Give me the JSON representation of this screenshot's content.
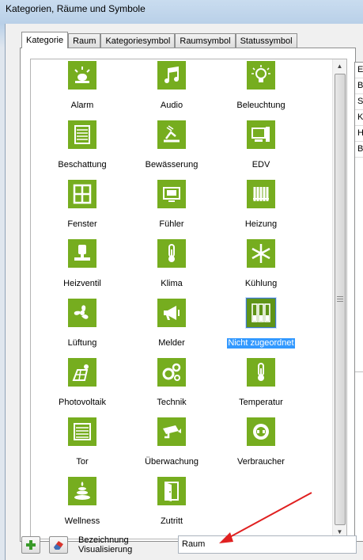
{
  "window": {
    "title": "Kategorien, Räume und Symbole"
  },
  "tabs": [
    "Kategorie",
    "Raum",
    "Kategoriesymbol",
    "Raumsymbol",
    "Statussymbol"
  ],
  "active_tab": "Kategorie",
  "categories": [
    {
      "label": "Alarm",
      "icon": "alarm-icon"
    },
    {
      "label": "Audio",
      "icon": "music-icon"
    },
    {
      "label": "Beleuchtung",
      "icon": "lightbulb-icon"
    },
    {
      "label": "Beschattung",
      "icon": "blinds-icon"
    },
    {
      "label": "Bewässerung",
      "icon": "sprinkler-icon"
    },
    {
      "label": "EDV",
      "icon": "computer-icon"
    },
    {
      "label": "Fenster",
      "icon": "window-icon"
    },
    {
      "label": "Fühler",
      "icon": "sensor-icon"
    },
    {
      "label": "Heizung",
      "icon": "radiator-icon"
    },
    {
      "label": "Heizventil",
      "icon": "valve-icon"
    },
    {
      "label": "Klima",
      "icon": "thermometer-icon"
    },
    {
      "label": "Kühlung",
      "icon": "snowflake-icon"
    },
    {
      "label": "Lüftung",
      "icon": "fan-icon"
    },
    {
      "label": "Melder",
      "icon": "megaphone-icon"
    },
    {
      "label": "Nicht zugeordnet",
      "icon": "unassigned-icon",
      "selected": true
    },
    {
      "label": "Photovoltaik",
      "icon": "solar-panel-icon"
    },
    {
      "label": "Technik",
      "icon": "gears-icon"
    },
    {
      "label": "Temperatur",
      "icon": "thermometer-icon"
    },
    {
      "label": "Tor",
      "icon": "garage-door-icon"
    },
    {
      "label": "Überwachung",
      "icon": "camera-icon"
    },
    {
      "label": "Verbraucher",
      "icon": "power-socket-icon"
    },
    {
      "label": "Wellness",
      "icon": "spa-stones-icon"
    },
    {
      "label": "Zutritt",
      "icon": "door-icon"
    }
  ],
  "right_list": [
    "E",
    "B",
    "S",
    "K",
    "H",
    "B"
  ],
  "bottom": {
    "add_icon": "plus-icon",
    "remove_icon": "eraser-icon",
    "label_line1": "Bezeichnung",
    "label_line2": "Visualisierung",
    "name_value": "Raum"
  },
  "colors": {
    "tile": "#76ad1f",
    "selection": "#3399ff",
    "arrow": "#e02020"
  }
}
